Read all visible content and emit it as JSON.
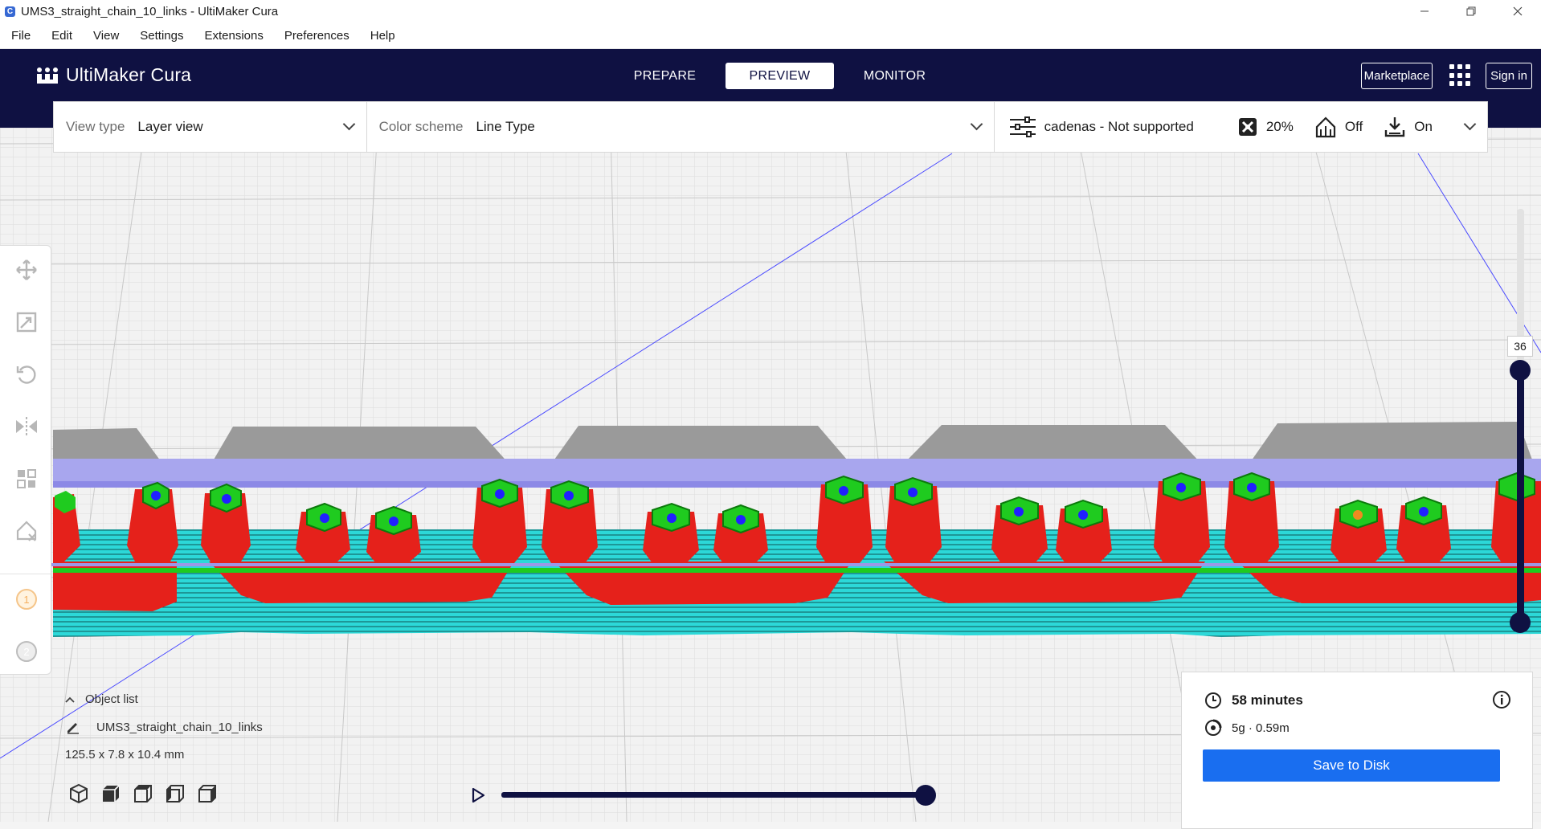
{
  "window": {
    "title": "UMS3_straight_chain_10_links - UltiMaker Cura",
    "app_icon": "C",
    "controls": [
      "minimize-icon",
      "restore-icon",
      "close-icon"
    ]
  },
  "menubar": {
    "items": [
      "File",
      "Edit",
      "View",
      "Settings",
      "Extensions",
      "Preferences",
      "Help"
    ]
  },
  "header": {
    "logo_text": "UltiMaker Cura",
    "stages": [
      {
        "label": "PREPARE",
        "active": false
      },
      {
        "label": "PREVIEW",
        "active": true
      },
      {
        "label": "MONITOR",
        "active": false
      }
    ],
    "marketplace_label": "Marketplace",
    "signin_label": "Sign in"
  },
  "view_toolbar": {
    "view_type_label": "View type",
    "view_type_value": "Layer view",
    "color_scheme_label": "Color scheme",
    "color_scheme_value": "Line Type",
    "profile_name": "cadenas - Not supported",
    "infill_value": "20%",
    "support_value": "Off",
    "adhesion_value": "On"
  },
  "tools": [
    "move-icon",
    "scale-icon",
    "rotate-icon",
    "mirror-icon",
    "per-model-settings-icon",
    "support-blocker-icon",
    "extruder-1-icon",
    "extruder-2-icon"
  ],
  "extruders": [
    "1",
    "2"
  ],
  "object_list": {
    "header": "Object list",
    "item_name": "UMS3_straight_chain_10_links",
    "dimensions": "125.5 x 7.8 x 10.4 mm",
    "view_buttons": [
      "3d-view-icon",
      "front-view-icon",
      "top-view-icon",
      "left-view-icon",
      "right-view-icon"
    ]
  },
  "layer_slider": {
    "current_layer": "36"
  },
  "print_info": {
    "time": "58 minutes",
    "material": "5g · 0.59m",
    "save_label": "Save to Disk"
  },
  "colors": {
    "header_bg": "#0f1142",
    "accent_blue": "#196ef0",
    "wall_red": "#e5211b",
    "skin_green": "#1fcb1f",
    "infill_cyan": "#2cd8d8",
    "travel_blue": "#2020ff",
    "support_gray": "#9a9a9a",
    "top_lavender": "#a8a6ee"
  }
}
